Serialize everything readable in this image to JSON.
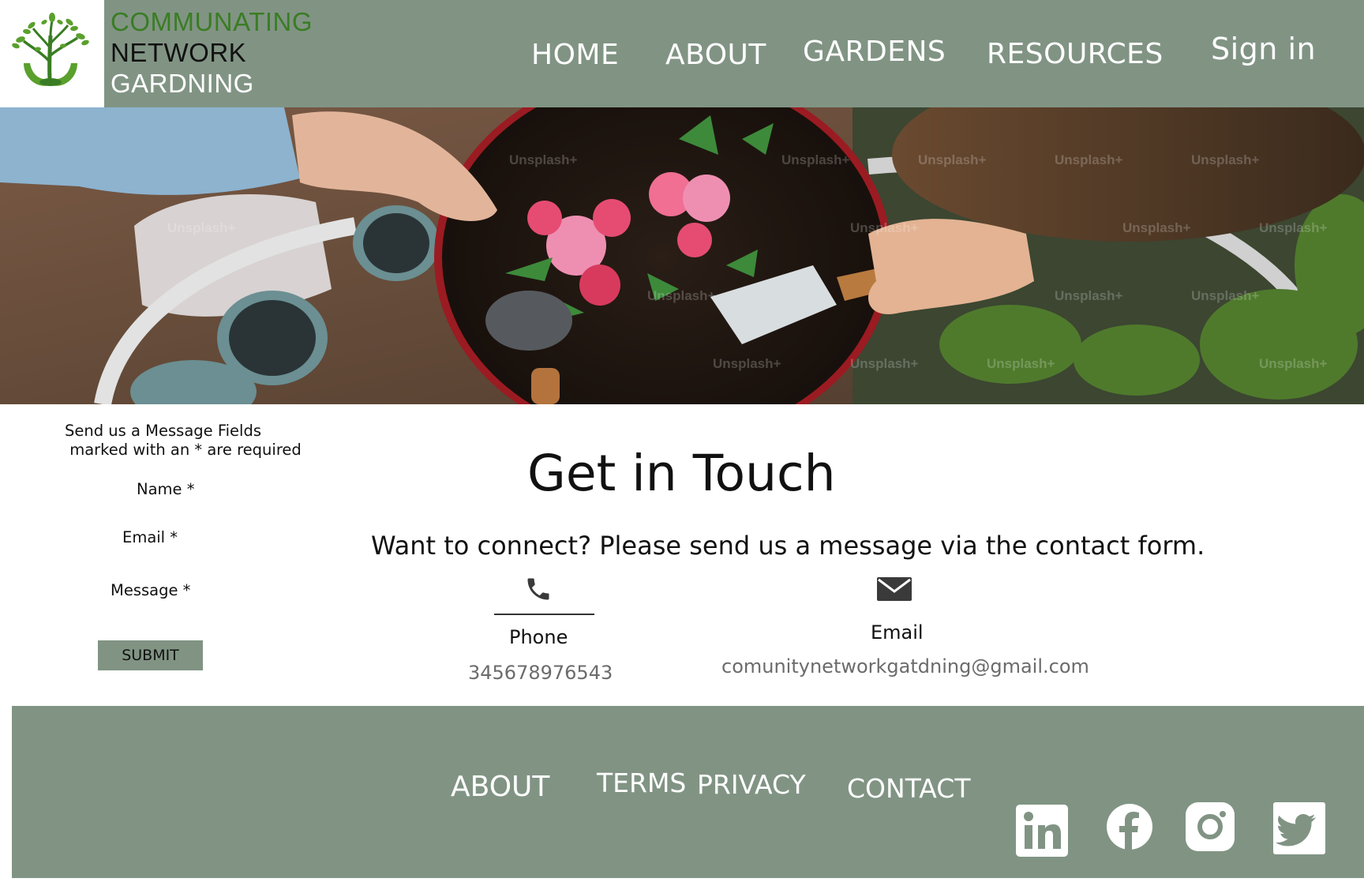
{
  "brand": {
    "line1": "COMMUNATING",
    "line2": "NETWORK",
    "line3": "GARDNING"
  },
  "nav": {
    "home": "HOME",
    "about": "ABOUT",
    "gardens": "GARDENS",
    "resources": "RESOURCES",
    "sign_in": "Sign in"
  },
  "hero": {
    "watermark": "Unsplash+"
  },
  "form": {
    "intro": "Send us a Message Fields\n marked with an * are required",
    "name_label": "Name *",
    "email_label": "Email *",
    "message_label": "Message *",
    "submit_label": "SUBMIT"
  },
  "contact": {
    "title": "Get in Touch",
    "subtitle": "Want to connect? Please send us a message via the contact form.",
    "phone_label": "Phone",
    "phone_value": "345678976543",
    "email_label": "Email",
    "email_value": "comunitynetworkgatdning@gmail.com"
  },
  "footer": {
    "about": "ABOUT",
    "terms": "TERMS",
    "privacy": "PRIVACY",
    "contact": "CONTACT"
  },
  "social_icons": [
    "linkedin-icon",
    "facebook-icon",
    "instagram-icon",
    "twitter-icon"
  ],
  "colors": {
    "sage": "#819484",
    "brand_green": "#3a7d24",
    "muted_text": "#6b6b6b"
  }
}
